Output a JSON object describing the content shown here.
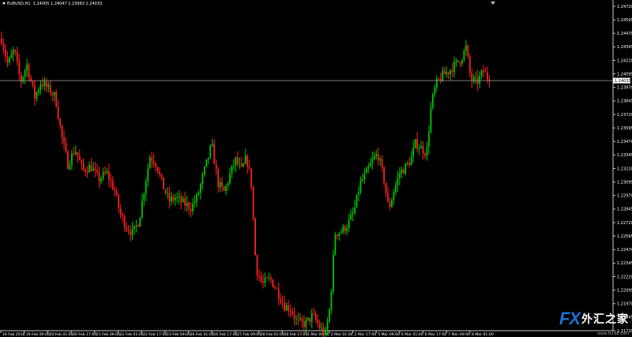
{
  "header": {
    "symbol_timeframe": "EURUSD,H1",
    "ohlc": "1.24005 1.24047 1.23993 1.24033"
  },
  "price_axis": {
    "labels": [
      "1.24720",
      "1.24595",
      "1.24470",
      "1.24345",
      "1.24220",
      "1.24095",
      "1.23970",
      "1.23845",
      "1.23720",
      "1.23595",
      "1.23470",
      "1.23345",
      "1.23220",
      "1.23095",
      "1.22970",
      "1.22845",
      "1.22720",
      "1.22595",
      "1.22470",
      "1.22345",
      "1.22220",
      "1.22095",
      "1.21970",
      "1.21845",
      "1.21720"
    ],
    "current_price_label": "1.24033"
  },
  "time_axis": {
    "labels": [
      "16 Feb 2018",
      "19 Feb 09:00",
      "20 Feb 01:00",
      "20 Feb 17:00",
      "21 Feb 09:00",
      "22 Feb 01:00",
      "22 Feb 17:00",
      "23 Feb 09:00",
      "26 Feb 01:00",
      "26 Feb 17:00",
      "27 Feb 09:00",
      "28 Feb 01:00",
      "28 Feb 17:00",
      "1 Mar 09:00",
      "2 Mar 01:00",
      "2 Mar 17:00",
      "5 Mar 09:00",
      "6 Mar 01:00",
      "6 Mar 17:00",
      "7 Mar 09:00",
      "8 Mar 01:00"
    ]
  },
  "chart_data": {
    "type": "candlestick",
    "symbol": "EURUSD",
    "timeframe": "H1",
    "bull_color": "#00c800",
    "bear_color": "#ff2020",
    "background": "#000000",
    "ylim": [
      1.2166,
      1.2478
    ],
    "current_price": 1.24033,
    "path": [
      [
        0,
        1.2448
      ],
      [
        10,
        1.2418
      ],
      [
        18,
        1.2432
      ],
      [
        26,
        1.2402
      ],
      [
        34,
        1.2418
      ],
      [
        44,
        1.2388
      ],
      [
        52,
        1.2402
      ],
      [
        62,
        1.2395
      ],
      [
        70,
        1.2388
      ],
      [
        78,
        1.2352
      ],
      [
        86,
        1.2326
      ],
      [
        95,
        1.234
      ],
      [
        105,
        1.232
      ],
      [
        115,
        1.2324
      ],
      [
        125,
        1.2312
      ],
      [
        135,
        1.2318
      ],
      [
        145,
        1.2302
      ],
      [
        152,
        1.228
      ],
      [
        160,
        1.2268
      ],
      [
        168,
        1.2262
      ],
      [
        176,
        1.2274
      ],
      [
        183,
        1.2305
      ],
      [
        190,
        1.2334
      ],
      [
        198,
        1.2326
      ],
      [
        206,
        1.2306
      ],
      [
        214,
        1.2292
      ],
      [
        222,
        1.2295
      ],
      [
        232,
        1.229
      ],
      [
        242,
        1.2286
      ],
      [
        250,
        1.2296
      ],
      [
        258,
        1.2318
      ],
      [
        268,
        1.2344
      ],
      [
        276,
        1.2308
      ],
      [
        284,
        1.23
      ],
      [
        290,
        1.2314
      ],
      [
        298,
        1.233
      ],
      [
        306,
        1.232
      ],
      [
        312,
        1.2332
      ],
      [
        318,
        1.231
      ],
      [
        324,
        1.223
      ],
      [
        332,
        1.2215
      ],
      [
        342,
        1.222
      ],
      [
        350,
        1.221
      ],
      [
        360,
        1.2195
      ],
      [
        368,
        1.2192
      ],
      [
        376,
        1.218
      ],
      [
        386,
        1.2178
      ],
      [
        396,
        1.2186
      ],
      [
        404,
        1.2176
      ],
      [
        412,
        1.2168
      ],
      [
        418,
        1.2196
      ],
      [
        424,
        1.2262
      ],
      [
        432,
        1.2264
      ],
      [
        440,
        1.227
      ],
      [
        448,
        1.2282
      ],
      [
        456,
        1.2308
      ],
      [
        464,
        1.2318
      ],
      [
        472,
        1.233
      ],
      [
        478,
        1.2336
      ],
      [
        486,
        1.2312
      ],
      [
        492,
        1.2284
      ],
      [
        498,
        1.23
      ],
      [
        506,
        1.2318
      ],
      [
        512,
        1.2322
      ],
      [
        520,
        1.233
      ],
      [
        526,
        1.2346
      ],
      [
        534,
        1.234
      ],
      [
        540,
        1.2336
      ],
      [
        546,
        1.2382
      ],
      [
        552,
        1.24
      ],
      [
        560,
        1.2408
      ],
      [
        568,
        1.2412
      ],
      [
        576,
        1.2418
      ],
      [
        584,
        1.2424
      ],
      [
        590,
        1.2434
      ],
      [
        596,
        1.2404
      ],
      [
        604,
        1.2402
      ],
      [
        612,
        1.2412
      ],
      [
        620,
        1.2403
      ]
    ]
  },
  "watermark": {
    "logo_latin": "FX",
    "logo_cn": "外汇之家",
    "url": "www.fx168.com"
  }
}
